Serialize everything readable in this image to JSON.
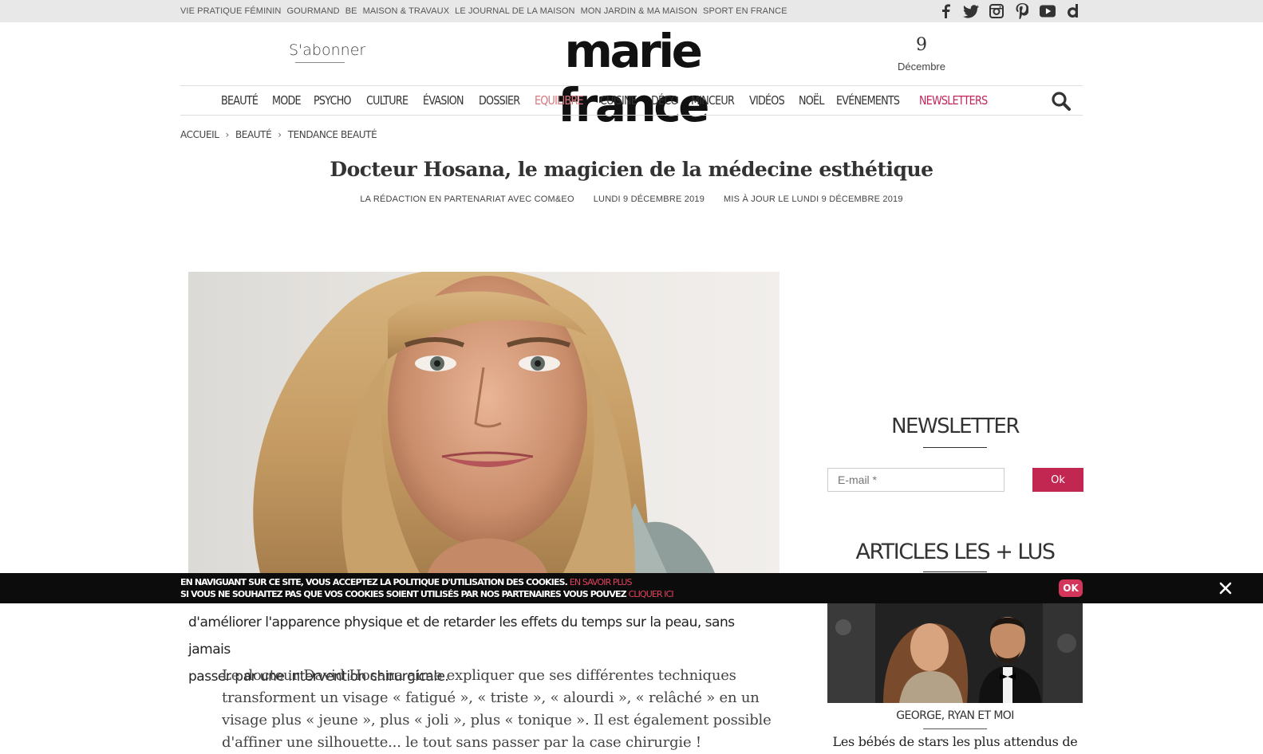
{
  "topbar": {
    "links": [
      "Vie Pratique Féminin",
      "Gourmand",
      "BE",
      "Maison & Travaux",
      "Le Journal de la Maison",
      "Mon Jardin & Ma Maison",
      "Sport en France"
    ],
    "social_icons": [
      "facebook-icon",
      "twitter-icon",
      "instagram-icon",
      "pinterest-icon",
      "youtube-icon",
      "dailymotion-icon"
    ]
  },
  "header": {
    "subscribe": "S'abonner",
    "logo": "marie france",
    "date_day": "9",
    "date_month": "Décembre"
  },
  "nav": {
    "items": [
      "BEAUTÉ",
      "MODE",
      "PSYCHO",
      "CULTURE",
      "ÉVASION",
      "DOSSIER",
      "EQUILIBRE",
      "CUISINE",
      "DÉCO",
      "MINCEUR",
      "VIDÉOS",
      "NOËL",
      "EVÉNEMENTS",
      "NEWSLETTERS"
    ],
    "search_icon": "search-icon"
  },
  "breadcrumb": {
    "items": [
      "ACCUEIL",
      "BEAUTÉ",
      "TENDANCE BEAUTÉ"
    ],
    "separator": "›"
  },
  "article": {
    "title": "Docteur Hosana, le magicien de la médecine esthétique",
    "author": "LA RÉDACTION EN PARTENARIAT AVEC COM&EO",
    "date": "LUNDI 9 DÉCEMBRE 2019",
    "updated": "MIS À JOUR LE LUNDI 9 DÉCEMBRE 2019",
    "lead_line1": "d'améliorer l'apparence physique et de retarder les effets du temps sur la peau, sans jamais",
    "lead_line2": "passer par une intervention chirurgicale.",
    "body": "Le docteur David Hosana aime expliquer que ses différentes techniques transforment un visage « fatigué », « triste », « alourdi », « relâché » en un visage plus « jeune », plus « joli », plus « tonique ». Il est également possible d'affiner une silhouette... le tout sans passer par la case chirurgie !"
  },
  "sidebar": {
    "newsletter_title": "NEWSLETTER",
    "email_placeholder": "E-mail *",
    "ok_label": "Ok",
    "popular_title": "ARTICLES LES + LUS",
    "popular_tag": "GEORGE, RYAN ET MOI",
    "popular_headline": "Les bébés de stars les plus attendus de"
  },
  "cookie": {
    "line1": "En naviguant sur ce site, vous acceptez la politique d'utilisation des cookies.",
    "line1_link": "En savoir plus",
    "line2": "Si vous ne souhaitez pas que vos cookies soient utilisés par nos partenaires vous pouvez",
    "line2_link": "cliquer ici",
    "ok_label": "OK"
  },
  "colors": {
    "accent": "#c22752",
    "equilibre": "#d9777e",
    "topbar_bg": "#e8e8e8",
    "cookie_bg": "#0c0c0c"
  }
}
